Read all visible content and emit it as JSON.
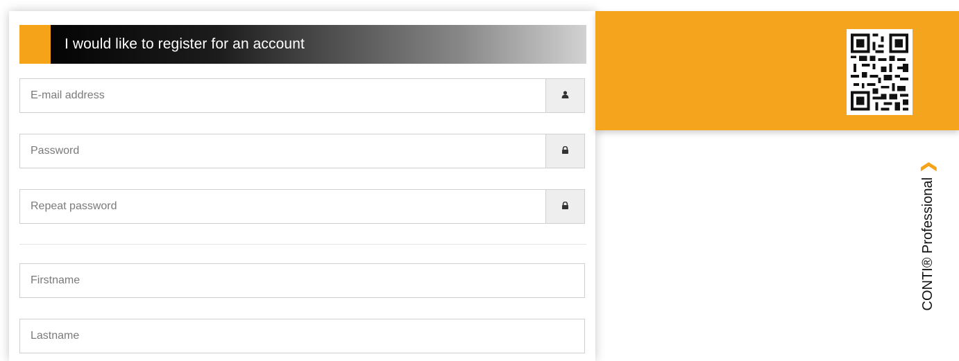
{
  "form": {
    "title": "I would like to register for an account",
    "fields": {
      "email": {
        "placeholder": "E-mail address",
        "value": "",
        "icon": "user-icon"
      },
      "password": {
        "placeholder": "Password",
        "value": "",
        "icon": "lock-icon"
      },
      "repeat_password": {
        "placeholder": "Repeat password",
        "value": "",
        "icon": "lock-icon"
      },
      "firstname": {
        "placeholder": "Firstname",
        "value": ""
      },
      "lastname": {
        "placeholder": "Lastname",
        "value": ""
      }
    }
  },
  "brand": {
    "label": "CONTI® Professional",
    "chevron": "❯",
    "accent_color": "#f5a319",
    "qr_icon": "qr-code-icon"
  }
}
